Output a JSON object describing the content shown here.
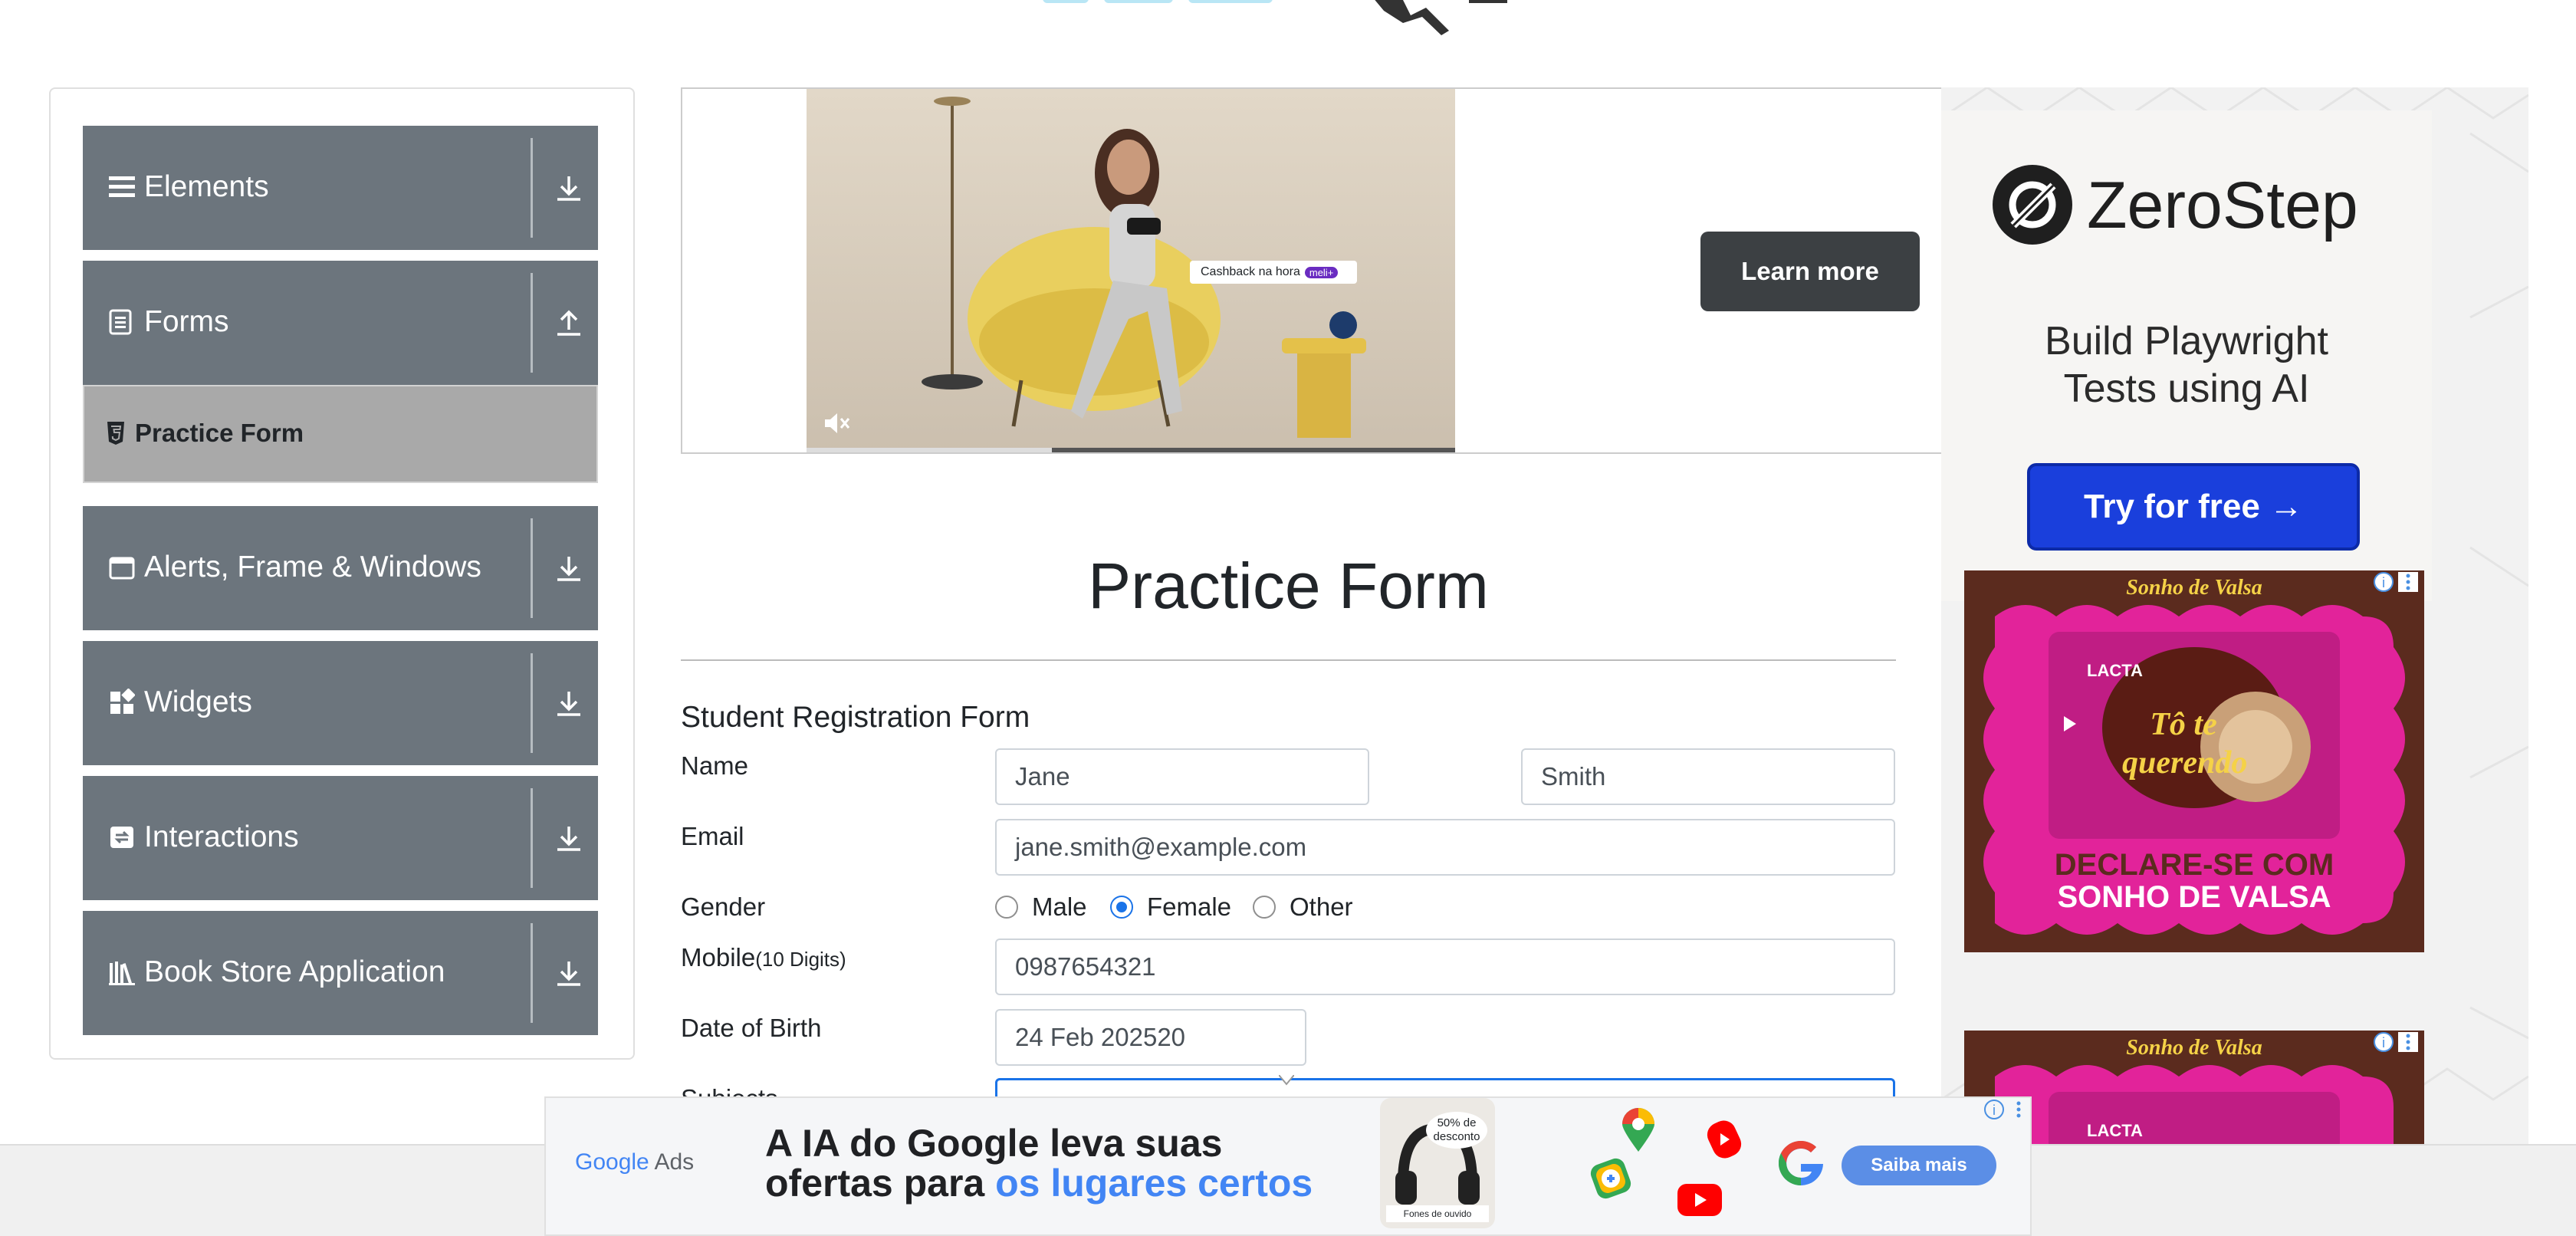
{
  "sidebar": {
    "groups": [
      {
        "label": "Elements",
        "icon": "list-icon",
        "arrow": "download-icon"
      },
      {
        "label": "Forms",
        "icon": "document-icon",
        "arrow": "upload-icon"
      },
      {
        "label": "Alerts, Frame & Windows",
        "icon": "window-icon",
        "arrow": "download-icon"
      },
      {
        "label": "Widgets",
        "icon": "widgets-icon",
        "arrow": "download-icon"
      },
      {
        "label": "Interactions",
        "icon": "interactions-icon",
        "arrow": "download-icon"
      },
      {
        "label": "Book Store Application",
        "icon": "books-icon",
        "arrow": "download-icon"
      }
    ],
    "active_item": {
      "label": "Practice Form",
      "icon": "html5-icon"
    }
  },
  "top_ad": {
    "video_caption": "Cashback na hora",
    "video_badge": "meli+",
    "mute_icon": "muted-speaker-icon",
    "cta": "Learn more"
  },
  "right_ad": {
    "brand": "ZeroStep",
    "headline_line1": "Build Playwright",
    "headline_line2": "Tests using AI",
    "cta": "Try for free →",
    "product_brand": "Sonho de Valsa",
    "product_maker": "LACTA",
    "product_tagline": "Tô te querendo",
    "product_slogan_line1": "DECLARE-SE COM",
    "product_slogan_line2": "SONHO DE VALSA",
    "colors": {
      "brand_blue": "#1a3fdc",
      "candy_pink": "#e2239a",
      "frame_brown": "#5b2b1e"
    }
  },
  "page": {
    "title": "Practice Form",
    "form_title": "Student Registration Form"
  },
  "form": {
    "name_label": "Name",
    "first_name": "Jane",
    "last_name": "Smith",
    "email_label": "Email",
    "email": "jane.smith@example.com",
    "gender_label": "Gender",
    "gender_options": [
      "Male",
      "Female",
      "Other"
    ],
    "gender_selected": "Female",
    "mobile_label": "Mobile",
    "mobile_hint": "(10 Digits)",
    "mobile": "0987654321",
    "dob_label": "Date of Birth",
    "dob": "24 Feb 202520",
    "subjects_label": "Subjects"
  },
  "bottom_ad": {
    "provider_google": "Google",
    "provider_ads": "Ads",
    "headline_line1": "A IA do Google leva suas",
    "headline_line2_prefix": "ofertas para ",
    "headline_line2_highlight": "os lugares certos",
    "discount_line1": "50% de",
    "discount_line2": "desconto",
    "product_label": "Fones de ouvido",
    "cta": "Saiba mais",
    "colors": {
      "accent_blue": "#4285f4",
      "cta_bg": "#5b8ee6"
    }
  },
  "colors": {
    "sidebar_group": "#6c757d",
    "active_item": "#a9a9a9",
    "radio_selected": "#1a73e8",
    "focus_border": "#1a73e8",
    "learn_more_bg": "#3c4043"
  }
}
